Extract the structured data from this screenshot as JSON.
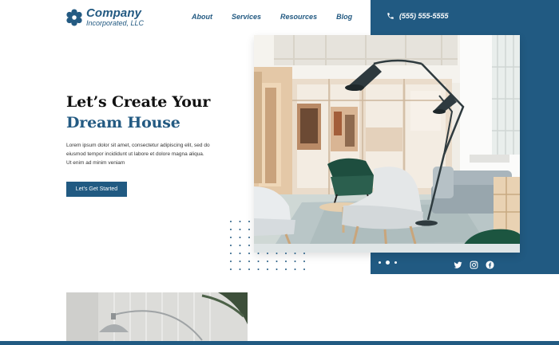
{
  "brand": {
    "name": "Company",
    "subtitle": "Incorporated, LLC",
    "accent": "#215a82"
  },
  "nav": {
    "items": [
      "About",
      "Services",
      "Resources",
      "Blog"
    ]
  },
  "contact": {
    "phone": "(555) 555-5555",
    "icon": "phone-icon"
  },
  "hero": {
    "title_line1": "Let’s Create Your",
    "title_line2": "Dream House",
    "lead": "Lorem ipsum dolor sit amet, consectetur adipiscing elit, sed do eiusmod tempor incididunt ut labore et dolore magna aliqua. Ut enim ad minim veniam",
    "cta": "Let’s Get Started"
  },
  "slider": {
    "count": 3,
    "active": 2
  },
  "socials": [
    "twitter-icon",
    "instagram-icon",
    "facebook-icon"
  ]
}
